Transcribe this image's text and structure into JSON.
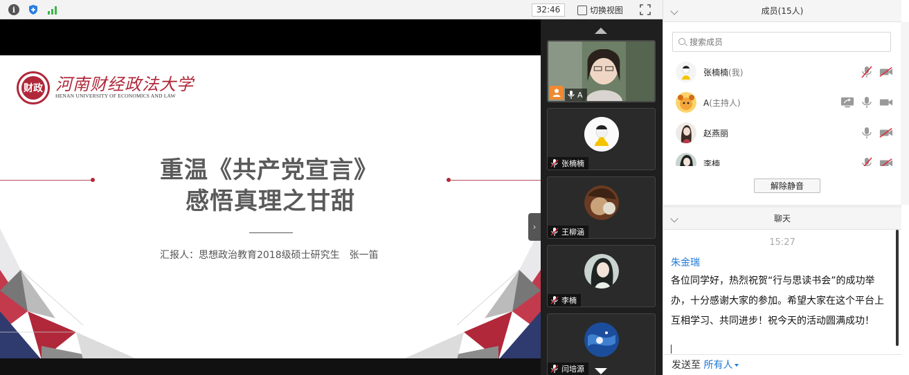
{
  "topbar": {
    "timer": "32:46",
    "switch_view_label": "切换视图"
  },
  "slide": {
    "university_cn": "河南财经政法大学",
    "university_en": "HENAN UNIVERSITY OF ECONOMICS AND LAW",
    "logo_char": "财政",
    "title_line1": "重温《共产党宣言》",
    "title_line2": "感悟真理之甘甜",
    "reporter": "汇报人：思想政治教育2018级硕士研究生　张一笛"
  },
  "videos": [
    {
      "name": "A",
      "camera_on": true,
      "is_host": true
    },
    {
      "name": "张楠楠",
      "camera_on": false,
      "muted": true
    },
    {
      "name": "王柳涵",
      "camera_on": false,
      "muted": true
    },
    {
      "name": "李楠",
      "camera_on": false,
      "muted": true
    },
    {
      "name": "闫培源",
      "camera_on": false,
      "muted": true
    }
  ],
  "members_panel": {
    "title": "成员(15人)",
    "search_placeholder": "搜索成员",
    "members": [
      {
        "name": "张楠楠",
        "role": "(我)",
        "mic": "muted",
        "camera": "off"
      },
      {
        "name": "A",
        "role": "(主持人)",
        "mic": "on",
        "camera": "on",
        "sharing": true
      },
      {
        "name": "赵燕丽",
        "role": "",
        "mic": "on",
        "camera": "off"
      },
      {
        "name": "李楠",
        "role": "",
        "mic": "muted",
        "camera": "off"
      }
    ],
    "unmute_all_label": "解除静音"
  },
  "chat_panel": {
    "title": "聊天",
    "time": "15:27",
    "sender": "朱金瑞",
    "message": "各位同学好，热烈祝贺“行与思读书会”的成功举办，十分感谢大家的参加。希望大家在这个平台上互相学习、共同进步！祝今天的活动圆满成功！",
    "send_to_label": "发送至",
    "send_to_target": "所有人"
  },
  "colors": {
    "brand_red": "#b0283a",
    "link_blue": "#1e78d7",
    "host_orange": "#f08a32"
  }
}
